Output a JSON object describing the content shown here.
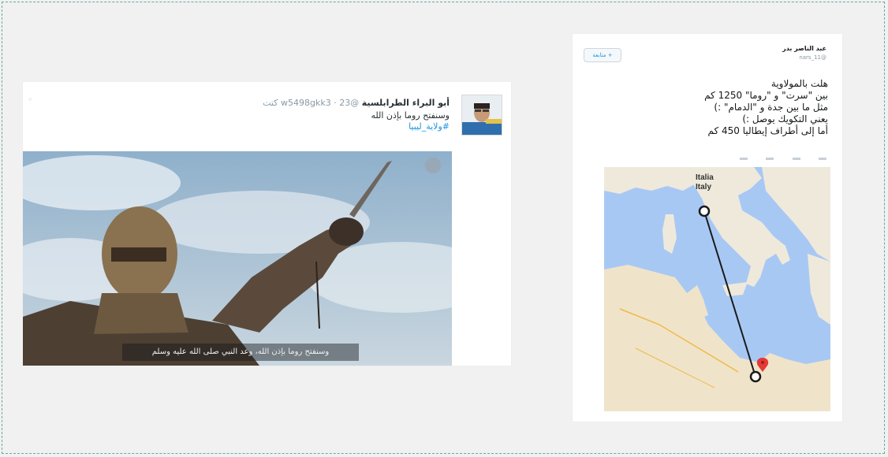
{
  "left_tweet": {
    "user_name": "أبو البراء الطرابلسية",
    "handle": "@w5498gkk3",
    "time": "23 كتت",
    "lines": [
      "وسنفتح روما بإذن الله"
    ],
    "hashtag": "#ولاية_ليبيا",
    "caret": "◦",
    "video_subtitle": "وسنفتح روما بإذن الله، وعد النبي صلى الله عليه وسلم"
  },
  "right_tweet": {
    "follow_label": "متابعة +",
    "author_name": "عبد الناصر بدر",
    "author_handle": "@nars_11",
    "lines": [
      "هلت بالمولاوية",
      "بين \"سرت\" و \"روما\" 1250 كم",
      "مثل ما بين جدة و \"الدمام\" :)",
      "يعني التكويك يوصل :)",
      "أما إلى أطراف إيطاليا 450 كم"
    ],
    "map": {
      "label_italia": "Italia",
      "label_italy": "Italy"
    }
  }
}
